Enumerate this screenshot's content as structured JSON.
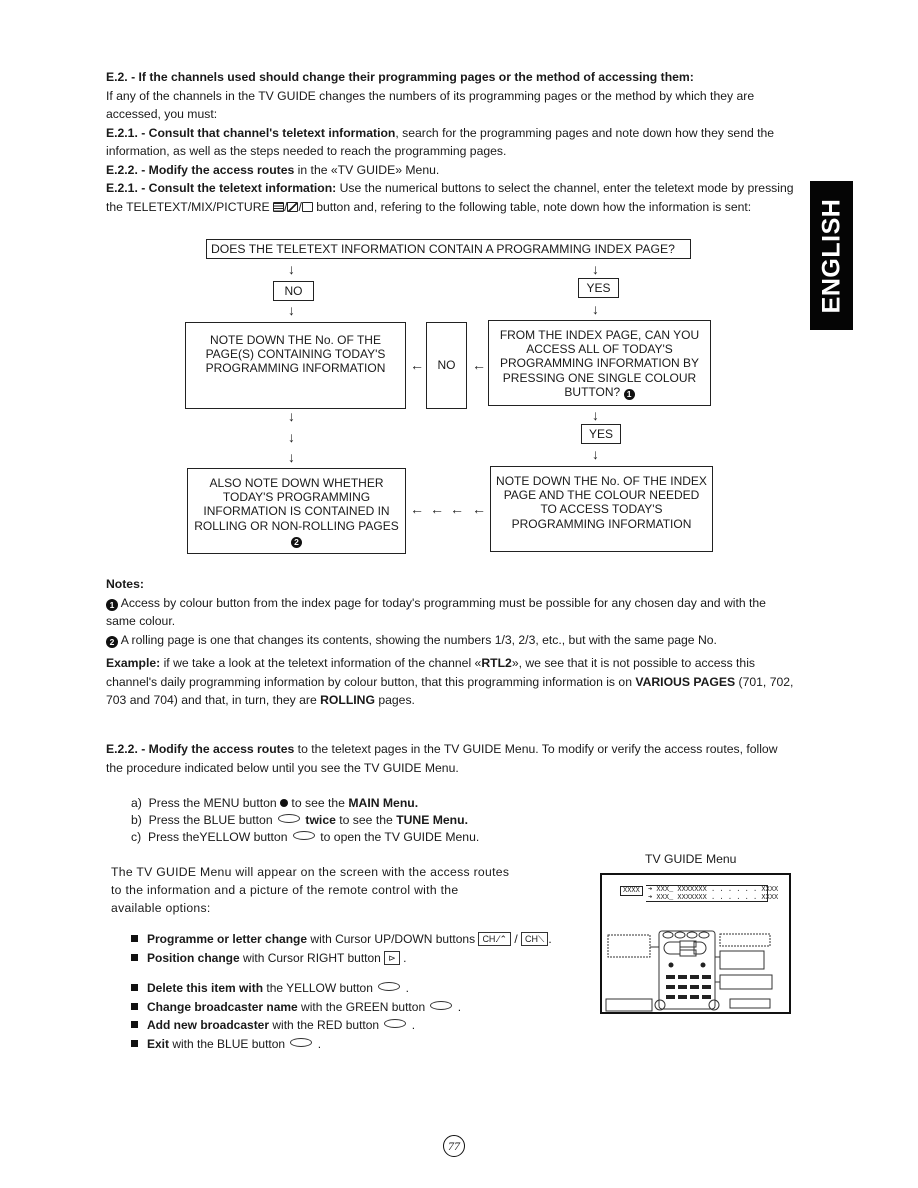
{
  "language_tab": "ENGLISH",
  "intro": {
    "heading_num": "E.2.",
    "heading_text": " - If the channels used should change their programming pages or the method of accessing them:",
    "para1": "If any of the channels in the TV GUIDE changes the numbers of its programming pages or the method by which they are accessed, you must:",
    "step1_num": "E.2.1.",
    "step1_bold": " - Consult that channel's teletext information",
    "step1_rest": ", search for the programming pages and note down how they send the information, as well as the steps needed to reach the programming pages.",
    "step2_num": "E.2.2.",
    "step2_bold": " - Modify the access routes",
    "step2_rest": " in the «TV GUIDE» Menu.",
    "step3_num": "E.2.1.",
    "step3_bold": " - Consult the teletext information:",
    "step3_rest_a": " Use the numerical buttons to select the channel, enter the teletext mode by pressing the TELETEXT/MIX/PICTURE ",
    "step3_icons_sep": "/",
    "step3_rest_b": " button and, refering to the following table, note down how the information is sent:"
  },
  "flowchart": {
    "question": "DOES THE TELETEXT INFORMATION CONTAIN A PROGRAMMING INDEX PAGE?",
    "no_label": "NO",
    "yes_label": "YES",
    "arrow_down": "↓",
    "arrow_left": "←",
    "box_note_pages": "NOTE DOWN THE No. OF THE PAGE(S) CONTAINING TODAY'S PROGRAMMING INFORMATION",
    "box_index_question": "FROM THE INDEX PAGE, CAN YOU ACCESS ALL OF TODAY'S PROGRAMMING INFORMATION BY PRESSING ONE SINGLE COLOUR BUTTON?",
    "middle_no": "NO",
    "yes2_label": "YES",
    "box_rolling": "ALSO NOTE DOWN WHETHER TODAY'S PROGRAMMING INFORMATION IS CONTAINED IN ROLLING OR NON-ROLLING PAGES",
    "box_index_colour": "NOTE DOWN THE No. OF THE INDEX PAGE AND THE COLOUR NEEDED TO ACCESS TODAY'S PROGRAMMING INFORMATION",
    "footnote1_marker": "1",
    "footnote2_marker": "2"
  },
  "notes": {
    "title": "Notes:",
    "note1_marker": "1",
    "note1": " Access by colour button from the index page for today's programming must be possible for any chosen day and with the same colour.",
    "note2_marker": "2",
    "note2": " A rolling page is one that changes its contents, showing the numbers 1/3, 2/3, etc., but with the same page No."
  },
  "example": {
    "label": "Example:",
    "text_a": " if we take a look at the teletext information of the channel «",
    "channel": "RTL2",
    "text_b": "», we see that it is not possible to access this channel's daily programming information by colour button, that this programming information is on ",
    "various": "VARIOUS PAGES",
    "text_c": " (701, 702, 703 and 704) and that, in turn, they are ",
    "rolling": "ROLLING",
    "text_d": " pages."
  },
  "modify": {
    "num": "E.2.2.",
    "bold": " - Modify the access routes",
    "rest": " to the teletext pages in the TV GUIDE Menu. To modify or verify the access routes, follow the procedure indicated below until you see the TV GUIDE Menu.",
    "steps": [
      {
        "letter": "a)",
        "pre": "Press the MENU button ",
        "icon": "dot",
        "mid": " to see the ",
        "bold": "MAIN Menu."
      },
      {
        "letter": "b)",
        "pre": "Press the BLUE button ",
        "icon": "oval",
        "mid": " ",
        "bold_a": "twice",
        "mid2": " to see the ",
        "bold": "TUNE Menu."
      },
      {
        "letter": "c)",
        "pre": "Press theYELLOW button ",
        "icon": "oval",
        "mid": " to open the TV GUIDE Menu."
      }
    ]
  },
  "tvguide": {
    "intro": "The TV GUIDE Menu will appear on the screen with the access routes to the information and a picture of the remote control with the available options:",
    "options": [
      {
        "bold": "Programme or letter change",
        "rest": " with Cursor UP/DOWN buttons ",
        "key1": "CH.⁄⌃",
        "sep": " / ",
        "key2": "CH⟍",
        "end": "."
      },
      {
        "bold": "Position change",
        "rest": " with Cursor RIGHT button ",
        "key1": "⊳",
        "end": "."
      },
      {
        "bold": "Delete this item with",
        "rest": " the YELLOW button ",
        "end": "."
      },
      {
        "bold": "Change broadcaster name",
        "rest": " with the GREEN button ",
        "end": "."
      },
      {
        "bold": "Add new broadcaster",
        "rest": " with the RED button ",
        "end": "."
      },
      {
        "bold": "Exit",
        "rest": " with the BLUE button ",
        "end": "."
      }
    ],
    "figure_caption": "TV GUIDE Menu",
    "screen_row1": {
      "a": "XXXX",
      "b": "➜ XXX_ XXXXXXX . . . . . . XXXX"
    },
    "screen_row2": {
      "b": "➜ XXX_ XXXXXXX . . . . . . XXXX"
    }
  },
  "page_number": "77"
}
